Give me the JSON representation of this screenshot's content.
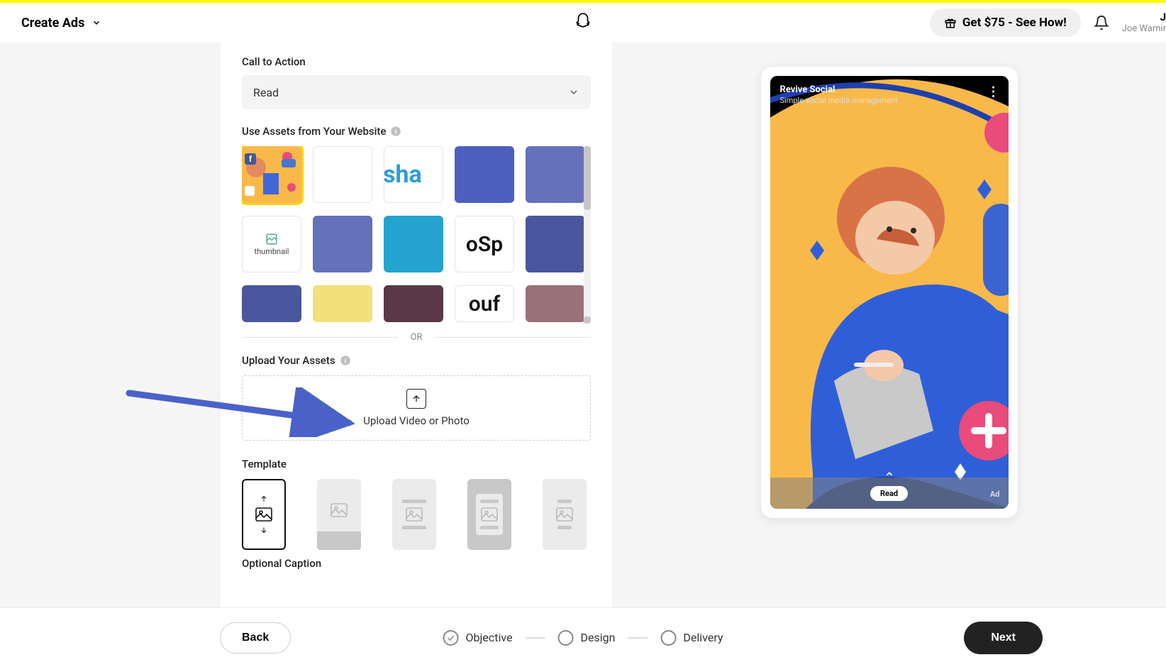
{
  "header": {
    "title": "Create Ads",
    "promo": "Get $75 - See How!",
    "user_letter": "J",
    "user_name": "Joe Warnir"
  },
  "form": {
    "cta_label": "Call to Action",
    "cta_value": "Read",
    "assets_label": "Use Assets from Your Website",
    "or_text": "OR",
    "upload_label": "Upload Your Assets",
    "upload_text": "Upload Video or Photo",
    "template_label": "Template",
    "optional_caption_label": "Optional Caption",
    "assets_alt": "thumbnail"
  },
  "preview": {
    "title": "Revive Social",
    "subtitle": "Simple social media management",
    "cta": "Read",
    "ad_tag": "Ad"
  },
  "footer": {
    "back": "Back",
    "next": "Next",
    "steps": [
      "Objective",
      "Design",
      "Delivery"
    ]
  },
  "asset_colors": {
    "sha_text": "sha",
    "osp_text": "oSp",
    "out_text": "ouf"
  }
}
